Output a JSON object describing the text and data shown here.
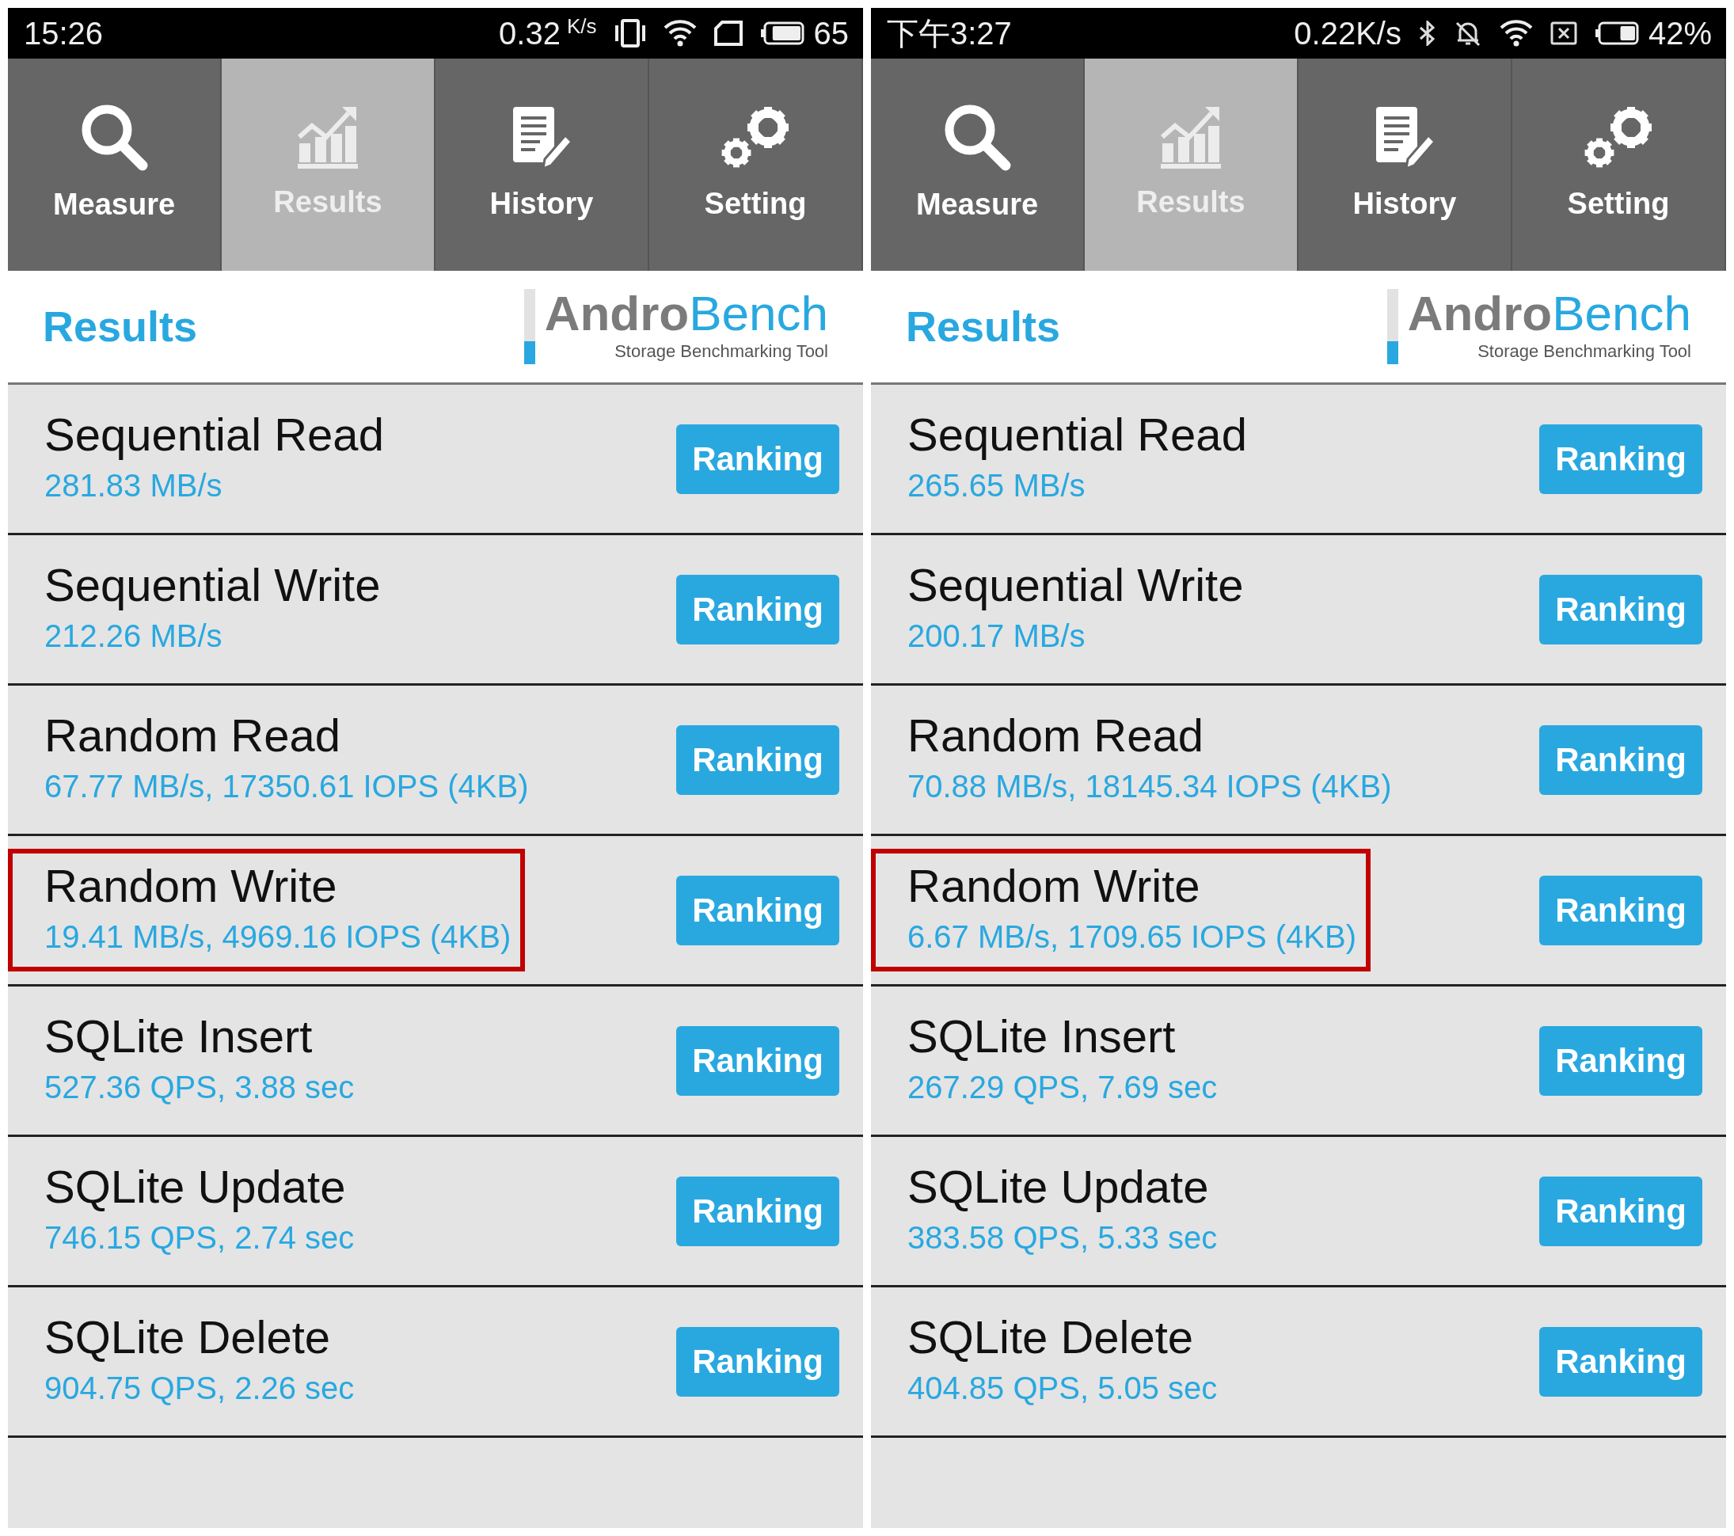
{
  "panels": [
    {
      "status_bar": {
        "time": "15:26",
        "speed": "0.32",
        "speed_unit": "K/s",
        "battery": "65"
      },
      "tabs": [
        {
          "label": "Measure",
          "selected": false
        },
        {
          "label": "Results",
          "selected": true
        },
        {
          "label": "History",
          "selected": false
        },
        {
          "label": "Setting",
          "selected": false
        }
      ],
      "header": {
        "title": "Results",
        "logo_first": "Andro",
        "logo_second": "Bench",
        "tagline": "Storage Benchmarking Tool"
      },
      "results": [
        {
          "name": "Sequential Read",
          "value": "281.83 MB/s",
          "button": "Ranking",
          "highlighted": false
        },
        {
          "name": "Sequential Write",
          "value": "212.26 MB/s",
          "button": "Ranking",
          "highlighted": false
        },
        {
          "name": "Random Read",
          "value": "67.77 MB/s, 17350.61 IOPS (4KB)",
          "button": "Ranking",
          "highlighted": false
        },
        {
          "name": "Random Write",
          "value": "19.41 MB/s, 4969.16 IOPS (4KB)",
          "button": "Ranking",
          "highlighted": true
        },
        {
          "name": "SQLite Insert",
          "value": "527.36 QPS, 3.88 sec",
          "button": "Ranking",
          "highlighted": false
        },
        {
          "name": "SQLite Update",
          "value": "746.15 QPS, 2.74 sec",
          "button": "Ranking",
          "highlighted": false
        },
        {
          "name": "SQLite Delete",
          "value": "904.75 QPS, 2.26 sec",
          "button": "Ranking",
          "highlighted": false
        }
      ]
    },
    {
      "status_bar": {
        "time": "下午3:27",
        "speed": "0.22K/s",
        "battery": "42%"
      },
      "tabs": [
        {
          "label": "Measure",
          "selected": false
        },
        {
          "label": "Results",
          "selected": true
        },
        {
          "label": "History",
          "selected": false
        },
        {
          "label": "Setting",
          "selected": false
        }
      ],
      "header": {
        "title": "Results",
        "logo_first": "Andro",
        "logo_second": "Bench",
        "tagline": "Storage Benchmarking Tool"
      },
      "results": [
        {
          "name": "Sequential Read",
          "value": "265.65 MB/s",
          "button": "Ranking",
          "highlighted": false
        },
        {
          "name": "Sequential Write",
          "value": "200.17 MB/s",
          "button": "Ranking",
          "highlighted": false
        },
        {
          "name": "Random Read",
          "value": "70.88 MB/s, 18145.34 IOPS (4KB)",
          "button": "Ranking",
          "highlighted": false
        },
        {
          "name": "Random Write",
          "value": "6.67 MB/s, 1709.65 IOPS (4KB)",
          "button": "Ranking",
          "highlighted": true
        },
        {
          "name": "SQLite Insert",
          "value": "267.29 QPS, 7.69 sec",
          "button": "Ranking",
          "highlighted": false
        },
        {
          "name": "SQLite Update",
          "value": "383.58 QPS, 5.33 sec",
          "button": "Ranking",
          "highlighted": false
        },
        {
          "name": "SQLite Delete",
          "value": "404.85 QPS, 5.05 sec",
          "button": "Ranking",
          "highlighted": false
        }
      ]
    }
  ]
}
